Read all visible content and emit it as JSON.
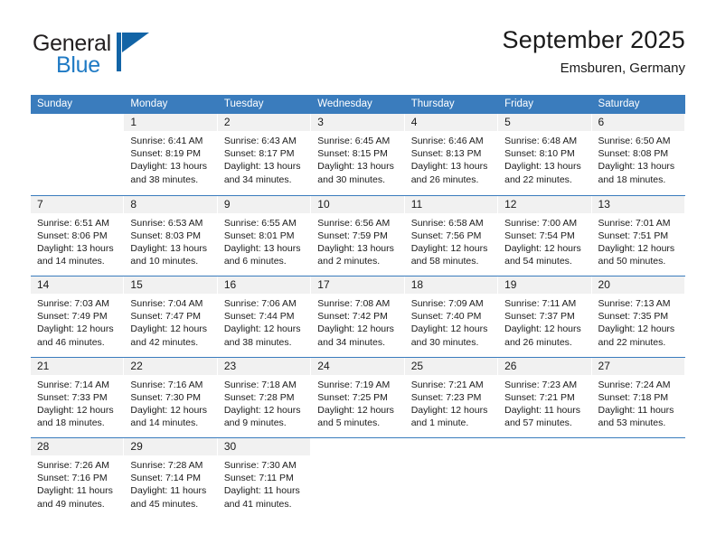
{
  "brand": {
    "name_dark": "General",
    "name_blue": "Blue",
    "logo_icon": "triangle-logo-icon",
    "accent_color": "#1264a6"
  },
  "header": {
    "title": "September 2025",
    "subtitle": "Emsburen, Germany"
  },
  "theme": {
    "header_blue": "#3a7cbd",
    "band_gray": "#f1f1f1",
    "text_dark": "#1a1a1a"
  },
  "calendar": {
    "weekday_headers": [
      "Sunday",
      "Monday",
      "Tuesday",
      "Wednesday",
      "Thursday",
      "Friday",
      "Saturday"
    ],
    "weeks": [
      [
        {
          "day": "",
          "blank": true,
          "sunrise": "",
          "sunset": "",
          "daylight1": "",
          "daylight2": ""
        },
        {
          "day": "1",
          "sunrise": "Sunrise: 6:41 AM",
          "sunset": "Sunset: 8:19 PM",
          "daylight1": "Daylight: 13 hours",
          "daylight2": "and 38 minutes."
        },
        {
          "day": "2",
          "sunrise": "Sunrise: 6:43 AM",
          "sunset": "Sunset: 8:17 PM",
          "daylight1": "Daylight: 13 hours",
          "daylight2": "and 34 minutes."
        },
        {
          "day": "3",
          "sunrise": "Sunrise: 6:45 AM",
          "sunset": "Sunset: 8:15 PM",
          "daylight1": "Daylight: 13 hours",
          "daylight2": "and 30 minutes."
        },
        {
          "day": "4",
          "sunrise": "Sunrise: 6:46 AM",
          "sunset": "Sunset: 8:13 PM",
          "daylight1": "Daylight: 13 hours",
          "daylight2": "and 26 minutes."
        },
        {
          "day": "5",
          "sunrise": "Sunrise: 6:48 AM",
          "sunset": "Sunset: 8:10 PM",
          "daylight1": "Daylight: 13 hours",
          "daylight2": "and 22 minutes."
        },
        {
          "day": "6",
          "sunrise": "Sunrise: 6:50 AM",
          "sunset": "Sunset: 8:08 PM",
          "daylight1": "Daylight: 13 hours",
          "daylight2": "and 18 minutes."
        }
      ],
      [
        {
          "day": "7",
          "sunrise": "Sunrise: 6:51 AM",
          "sunset": "Sunset: 8:06 PM",
          "daylight1": "Daylight: 13 hours",
          "daylight2": "and 14 minutes."
        },
        {
          "day": "8",
          "sunrise": "Sunrise: 6:53 AM",
          "sunset": "Sunset: 8:03 PM",
          "daylight1": "Daylight: 13 hours",
          "daylight2": "and 10 minutes."
        },
        {
          "day": "9",
          "sunrise": "Sunrise: 6:55 AM",
          "sunset": "Sunset: 8:01 PM",
          "daylight1": "Daylight: 13 hours",
          "daylight2": "and 6 minutes."
        },
        {
          "day": "10",
          "sunrise": "Sunrise: 6:56 AM",
          "sunset": "Sunset: 7:59 PM",
          "daylight1": "Daylight: 13 hours",
          "daylight2": "and 2 minutes."
        },
        {
          "day": "11",
          "sunrise": "Sunrise: 6:58 AM",
          "sunset": "Sunset: 7:56 PM",
          "daylight1": "Daylight: 12 hours",
          "daylight2": "and 58 minutes."
        },
        {
          "day": "12",
          "sunrise": "Sunrise: 7:00 AM",
          "sunset": "Sunset: 7:54 PM",
          "daylight1": "Daylight: 12 hours",
          "daylight2": "and 54 minutes."
        },
        {
          "day": "13",
          "sunrise": "Sunrise: 7:01 AM",
          "sunset": "Sunset: 7:51 PM",
          "daylight1": "Daylight: 12 hours",
          "daylight2": "and 50 minutes."
        }
      ],
      [
        {
          "day": "14",
          "sunrise": "Sunrise: 7:03 AM",
          "sunset": "Sunset: 7:49 PM",
          "daylight1": "Daylight: 12 hours",
          "daylight2": "and 46 minutes."
        },
        {
          "day": "15",
          "sunrise": "Sunrise: 7:04 AM",
          "sunset": "Sunset: 7:47 PM",
          "daylight1": "Daylight: 12 hours",
          "daylight2": "and 42 minutes."
        },
        {
          "day": "16",
          "sunrise": "Sunrise: 7:06 AM",
          "sunset": "Sunset: 7:44 PM",
          "daylight1": "Daylight: 12 hours",
          "daylight2": "and 38 minutes."
        },
        {
          "day": "17",
          "sunrise": "Sunrise: 7:08 AM",
          "sunset": "Sunset: 7:42 PM",
          "daylight1": "Daylight: 12 hours",
          "daylight2": "and 34 minutes."
        },
        {
          "day": "18",
          "sunrise": "Sunrise: 7:09 AM",
          "sunset": "Sunset: 7:40 PM",
          "daylight1": "Daylight: 12 hours",
          "daylight2": "and 30 minutes."
        },
        {
          "day": "19",
          "sunrise": "Sunrise: 7:11 AM",
          "sunset": "Sunset: 7:37 PM",
          "daylight1": "Daylight: 12 hours",
          "daylight2": "and 26 minutes."
        },
        {
          "day": "20",
          "sunrise": "Sunrise: 7:13 AM",
          "sunset": "Sunset: 7:35 PM",
          "daylight1": "Daylight: 12 hours",
          "daylight2": "and 22 minutes."
        }
      ],
      [
        {
          "day": "21",
          "sunrise": "Sunrise: 7:14 AM",
          "sunset": "Sunset: 7:33 PM",
          "daylight1": "Daylight: 12 hours",
          "daylight2": "and 18 minutes."
        },
        {
          "day": "22",
          "sunrise": "Sunrise: 7:16 AM",
          "sunset": "Sunset: 7:30 PM",
          "daylight1": "Daylight: 12 hours",
          "daylight2": "and 14 minutes."
        },
        {
          "day": "23",
          "sunrise": "Sunrise: 7:18 AM",
          "sunset": "Sunset: 7:28 PM",
          "daylight1": "Daylight: 12 hours",
          "daylight2": "and 9 minutes."
        },
        {
          "day": "24",
          "sunrise": "Sunrise: 7:19 AM",
          "sunset": "Sunset: 7:25 PM",
          "daylight1": "Daylight: 12 hours",
          "daylight2": "and 5 minutes."
        },
        {
          "day": "25",
          "sunrise": "Sunrise: 7:21 AM",
          "sunset": "Sunset: 7:23 PM",
          "daylight1": "Daylight: 12 hours",
          "daylight2": "and 1 minute."
        },
        {
          "day": "26",
          "sunrise": "Sunrise: 7:23 AM",
          "sunset": "Sunset: 7:21 PM",
          "daylight1": "Daylight: 11 hours",
          "daylight2": "and 57 minutes."
        },
        {
          "day": "27",
          "sunrise": "Sunrise: 7:24 AM",
          "sunset": "Sunset: 7:18 PM",
          "daylight1": "Daylight: 11 hours",
          "daylight2": "and 53 minutes."
        }
      ],
      [
        {
          "day": "28",
          "sunrise": "Sunrise: 7:26 AM",
          "sunset": "Sunset: 7:16 PM",
          "daylight1": "Daylight: 11 hours",
          "daylight2": "and 49 minutes."
        },
        {
          "day": "29",
          "sunrise": "Sunrise: 7:28 AM",
          "sunset": "Sunset: 7:14 PM",
          "daylight1": "Daylight: 11 hours",
          "daylight2": "and 45 minutes."
        },
        {
          "day": "30",
          "sunrise": "Sunrise: 7:30 AM",
          "sunset": "Sunset: 7:11 PM",
          "daylight1": "Daylight: 11 hours",
          "daylight2": "and 41 minutes."
        },
        {
          "day": "",
          "blank": true,
          "sunrise": "",
          "sunset": "",
          "daylight1": "",
          "daylight2": ""
        },
        {
          "day": "",
          "blank": true,
          "sunrise": "",
          "sunset": "",
          "daylight1": "",
          "daylight2": ""
        },
        {
          "day": "",
          "blank": true,
          "sunrise": "",
          "sunset": "",
          "daylight1": "",
          "daylight2": ""
        },
        {
          "day": "",
          "blank": true,
          "sunrise": "",
          "sunset": "",
          "daylight1": "",
          "daylight2": ""
        }
      ]
    ]
  }
}
